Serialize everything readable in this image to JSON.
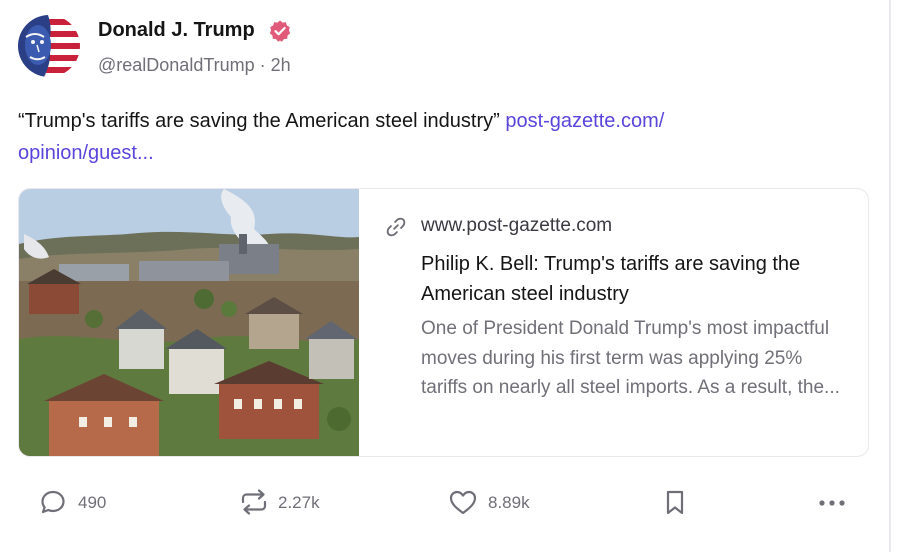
{
  "post": {
    "author": {
      "name": "Donald J. Trump",
      "handle_time": "@realDonaldTrump · 2h",
      "verified_icon": "verified-badge-icon",
      "verified_color": "#e05a7a"
    },
    "text": "“Trump's tariffs are saving the American steel industry”",
    "link_text_line1": "post-gazette.com/",
    "link_text_line2": "opinion/guest...",
    "link_color": "#5a45dc"
  },
  "link_card": {
    "domain": "www.post-gazette.com",
    "title": "Philip K. Bell: Trump's tariffs are saving the American steel industry",
    "description": "One of President Donald Trump's most impactful moves during his first term was applying 25% tariffs on nearly all steel imports. As a result, the...",
    "image_icon": "steel-town-photo"
  },
  "actions": {
    "replies": "490",
    "reposts": "2.27k",
    "likes": "8.89k",
    "reply_icon": "comment-icon",
    "repost_icon": "repost-icon",
    "like_icon": "heart-icon",
    "bookmark_icon": "bookmark-icon",
    "more_icon": "more-icon"
  }
}
